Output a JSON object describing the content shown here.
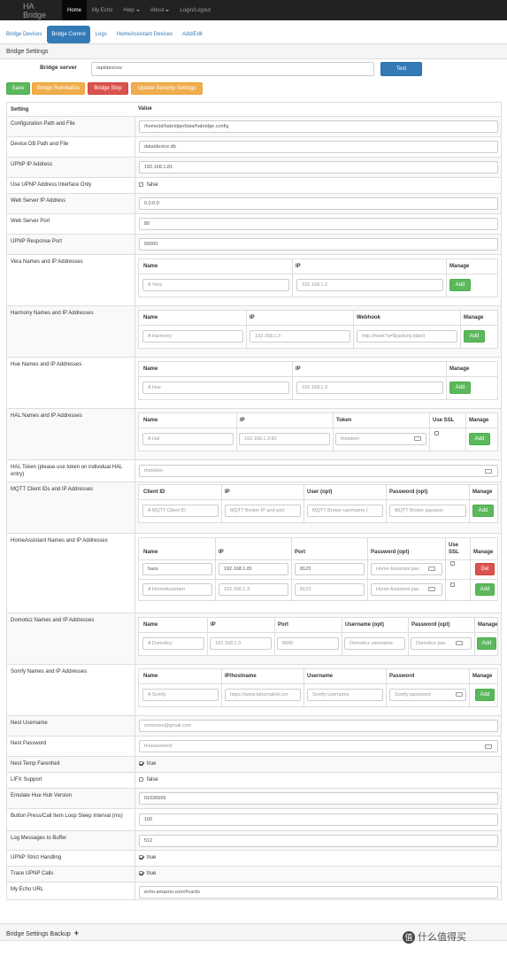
{
  "nav": {
    "brand": "HA Bridge",
    "items": [
      {
        "label": "Home",
        "active": true
      },
      {
        "label": "My Echo"
      },
      {
        "label": "Help",
        "caret": true
      },
      {
        "label": "About",
        "caret": true
      },
      {
        "label": "Login/Logout"
      }
    ]
  },
  "tabs": [
    "Bridge Devices",
    "Bridge Control",
    "Logs",
    "HomeAssistant Devices",
    "Add/Edit"
  ],
  "panel_title": "Bridge Settings",
  "server": {
    "label": "Bridge server",
    "value": "/api/devices",
    "test": "Test"
  },
  "actions": {
    "save": "Save",
    "reinit": "Bridge Reinitialize",
    "stop": "Bridge Stop",
    "security": "Update Security Settings"
  },
  "table": {
    "setting": "Setting",
    "value": "Value"
  },
  "rows": {
    "config_path": {
      "label": "Configuration Path and File",
      "value": "/home/pi/habridge/data/habridge.config"
    },
    "device_db": {
      "label": "Device DB Path and File",
      "value": "data/device.db"
    },
    "upnp_ip": {
      "label": "UPNP IP Address",
      "value": "192.168.1.81"
    },
    "upnp_iface": {
      "label": "Use UPNP Address Interface Only",
      "value": "false"
    },
    "web_ip": {
      "label": "Web Server IP Address",
      "value": "0.0.0.0"
    },
    "web_port": {
      "label": "Web Server Port",
      "value": "80"
    },
    "upnp_resp": {
      "label": "UPNP Response Port",
      "value": "50000"
    },
    "vera": {
      "label": "Vera Names and IP Addresses",
      "h_name": "Name",
      "h_ip": "IP",
      "h_manage": "Manage",
      "ph_name": "A Vera",
      "ph_ip": "192.168.1.2",
      "add": "Add"
    },
    "harmony": {
      "label": "Harmony Names and IP Addresses",
      "h_name": "Name",
      "h_ip": "IP",
      "h_webhook": "Webhook",
      "h_manage": "Manage",
      "ph_name": "A Harmony",
      "ph_ip": "192.168.1.3",
      "ph_webhook": "http://hook?a=${activity.label}",
      "add": "Add"
    },
    "hue": {
      "label": "Hue Names and IP Addresses",
      "h_name": "Name",
      "h_ip": "IP",
      "h_manage": "Manage",
      "ph_name": "A Hue",
      "ph_ip": "192.168.1.3",
      "add": "Add"
    },
    "hal": {
      "label": "HAL Names and IP Addresses",
      "h_name": "Name",
      "h_ip": "IP",
      "h_token": "Token",
      "h_ssl": "Use SSL",
      "h_manage": "Manage",
      "ph_name": "A Hal",
      "ph_ip": "192.168.1.3:82",
      "ph_token": "thetoken",
      "add": "Add"
    },
    "hal_token": {
      "label": "HAL Token (please use token on individual HAL entry)",
      "placeholder": "thetoken"
    },
    "mqtt": {
      "label": "MQTT Client IDs and IP Addresses",
      "h_client": "Client ID",
      "h_ip": "IP",
      "h_user": "User (opt)",
      "h_pass": "Password (opt)",
      "h_manage": "Manage",
      "ph_client": "A MQTT Client ID",
      "ph_ip": "MQTT Broker IP and port",
      "ph_user": "MQTT Broker username (",
      "ph_pass": "MQTT Broker passwor",
      "add": "Add"
    },
    "ha": {
      "label": "HomeAssistant Names and IP Addresses",
      "h_name": "Name",
      "h_ip": "IP",
      "h_port": "Port",
      "h_pass": "Password (opt)",
      "h_ssl1": "Use",
      "h_ssl2": "SSL",
      "h_manage": "Manage",
      "r1_name": "hass",
      "r1_ip": "192.168.1.81",
      "r1_port": "8123",
      "r1_pass": "Home Assistant pas",
      "del": "Del",
      "ph_name": "A HomeAssistant",
      "ph_ip": "192.168.1.3",
      "ph_port": "8123",
      "ph_pass": "Home Assistant pas",
      "add": "Add"
    },
    "domoticz": {
      "label": "Domoticz Names and IP Addresses",
      "h_name": "Name",
      "h_ip": "IP",
      "h_port": "Port",
      "h_user": "Username (opt)",
      "h_pass": "Password (opt)",
      "h_manage": "Manage",
      "ph_name": "A Domoticz",
      "ph_ip": "192.168.1.3",
      "ph_port": "8080",
      "ph_user": "Domoticz username",
      "ph_pass": "Domoticz pas",
      "add": "Add"
    },
    "somfy": {
      "label": "Somfy Names and IP Addresses",
      "h_name": "Name",
      "h_ip": "IP/hostname",
      "h_user": "Username",
      "h_pass": "Password",
      "h_manage": "Manage",
      "ph_name": "A Somfy",
      "ph_ip": "https://www.tahomalink.cor",
      "ph_user": "Somfy username",
      "ph_pass": "Somfy password",
      "add": "Add"
    },
    "nest_user": {
      "label": "Nest Username",
      "placeholder": "someone@gmail.com"
    },
    "nest_pass": {
      "label": "Nest Password",
      "placeholder": "thepassword"
    },
    "nest_temp": {
      "label": "Nest Temp Farenheit",
      "value": "true"
    },
    "lifx": {
      "label": "LIFX Support",
      "value": "false"
    },
    "hub_ver": {
      "label": "Emulate Hue Hub Version",
      "value": "01036659"
    },
    "sleep": {
      "label": "Button Press/Call Item Loop Sleep Interval (ms)",
      "value": "100"
    },
    "log_buf": {
      "label": "Log Messages to Buffer",
      "value": "512"
    },
    "upnp_strict": {
      "label": "UPNP Strict Handling",
      "value": "true"
    },
    "trace": {
      "label": "Trace UPNP Calls",
      "value": "true"
    },
    "echo_url": {
      "label": "My Echo URL",
      "value": "echo.amazon.com/#cards"
    }
  },
  "footer": "Bridge Settings Backup",
  "watermark": "什么值得买"
}
